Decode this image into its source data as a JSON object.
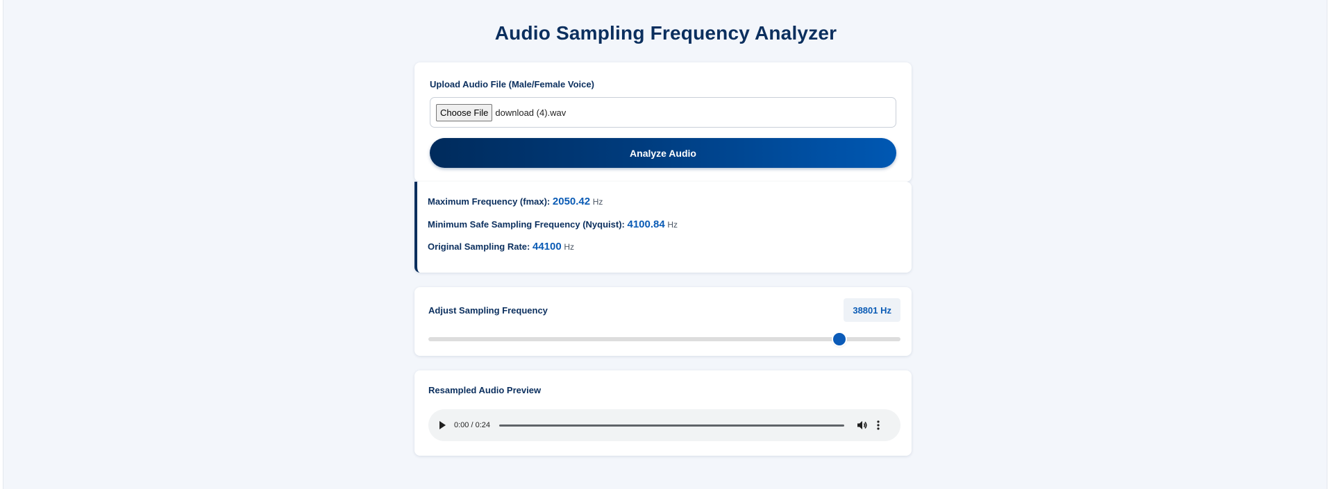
{
  "page": {
    "title": "Audio Sampling Frequency Analyzer"
  },
  "upload": {
    "label": "Upload Audio File (Male/Female Voice)",
    "choose_button": "Choose File",
    "file_name": "download (4).wav",
    "analyze_button": "Analyze Audio"
  },
  "results": {
    "fmax_label": "Maximum Frequency (fmax):",
    "fmax_value": "2050.42",
    "nyquist_label": "Minimum Safe Sampling Frequency (Nyquist):",
    "nyquist_value": "4100.84",
    "original_label": "Original Sampling Rate:",
    "original_value": "44100",
    "unit": "Hz"
  },
  "sampling": {
    "label": "Adjust Sampling Frequency",
    "display": "38801 Hz",
    "value": 38801,
    "slider_fraction": 0.87
  },
  "preview": {
    "label": "Resampled Audio Preview",
    "time": "0:00 / 0:24"
  },
  "colors": {
    "accent": "#0a5bb5",
    "navy": "#0b2f5e",
    "background": "#f3f6fb"
  }
}
